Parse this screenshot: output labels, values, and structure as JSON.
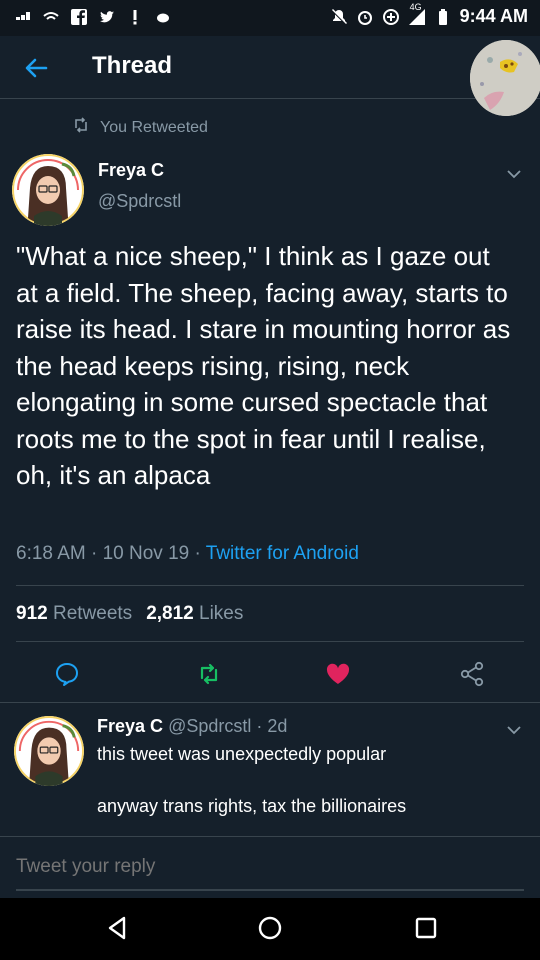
{
  "status_bar": {
    "time": "9:44 AM",
    "network_badge": "4G",
    "left_icons": [
      "signal-app-icon",
      "wifi-icon",
      "facebook-icon",
      "twitter-icon",
      "alert-icon",
      "dot-icon"
    ],
    "right_icons": [
      "mute-icon",
      "alarm-icon",
      "data-saver-icon",
      "cell-signal-icon",
      "battery-icon"
    ]
  },
  "header": {
    "title": "Thread",
    "back_icon": "arrow-left-icon"
  },
  "main_tweet": {
    "retweet_context": "You Retweeted",
    "author": {
      "name": "Freya C",
      "handle": "@Spdrcstl"
    },
    "text": "\"What a nice sheep,\" I think as I gaze out at a field. The sheep, facing away, starts to raise its head. I stare in mounting horror as the head keeps rising, rising, neck elongating in some cursed spectacle that roots me to the spot in fear until I realise, oh, it's an alpaca",
    "time": "6:18 AM",
    "date": "10 Nov 19",
    "client": "Twitter for Android",
    "separator": "·",
    "retweets_count": "912",
    "retweets_label": "Retweets",
    "likes_count": "2,812",
    "likes_label": "Likes"
  },
  "actions": {
    "reply_icon": "reply-icon",
    "retweet_icon": "retweet-icon",
    "like_icon": "heart-icon",
    "share_icon": "share-icon"
  },
  "reply_tweet": {
    "name": "Freya C",
    "handle": "@Spdrcstl",
    "age": "2d",
    "line1": "this tweet was unexpectedly popular",
    "line2": "anyway trans rights, tax the billionaires"
  },
  "composer": {
    "placeholder": "Tweet your reply"
  },
  "colors": {
    "background": "#15202b",
    "divider": "#38444d",
    "muted_text": "#8899a6",
    "accent": "#1da1f2",
    "retweet_green": "#17bf63",
    "like_red": "#e0245e"
  }
}
